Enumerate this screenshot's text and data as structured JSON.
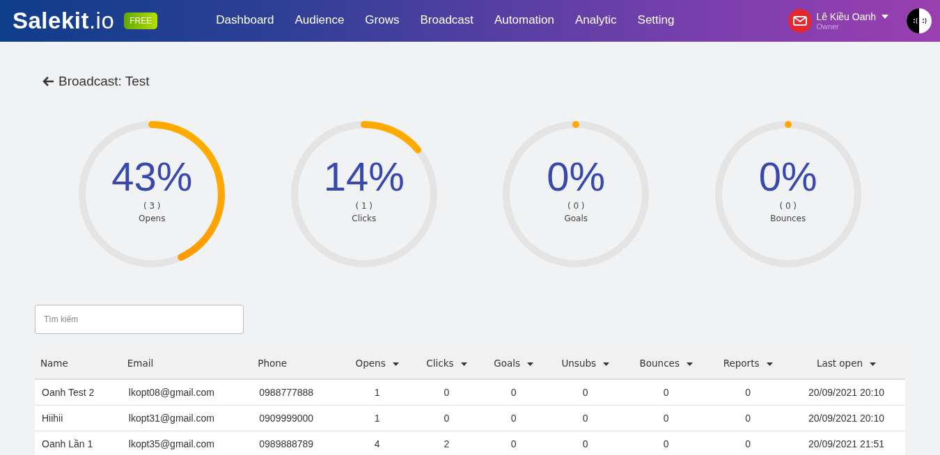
{
  "brand": {
    "name": "Salekit",
    "suffix": ".io",
    "badge": "FREE"
  },
  "nav": [
    {
      "label": "Dashboard",
      "selected": false
    },
    {
      "label": "Audience",
      "selected": false
    },
    {
      "label": "Grows",
      "selected": false
    },
    {
      "label": "Broadcast",
      "selected": false
    },
    {
      "label": "Automation",
      "selected": false
    },
    {
      "label": "Analytic",
      "selected": false
    },
    {
      "label": "Setting",
      "selected": false
    }
  ],
  "user": {
    "name": "Lê Kiều Oanh",
    "role": "Owner"
  },
  "page_title": "Broadcast: Test",
  "gauges": [
    {
      "percent": "43%",
      "count": "( 3 )",
      "label": "Opens",
      "level": 0.43
    },
    {
      "percent": "14%",
      "count": "( 1 )",
      "label": "Clicks",
      "level": 0.14
    },
    {
      "percent": "0%",
      "count": "( 0 )",
      "label": "Goals",
      "level": 0
    },
    {
      "percent": "0%",
      "count": "( 0 )",
      "label": "Bounces",
      "level": 0
    }
  ],
  "search": {
    "placeholder": "Tìm kiếm"
  },
  "table": {
    "columns": [
      {
        "label": "Name",
        "sortable": false
      },
      {
        "label": "Email",
        "sortable": false
      },
      {
        "label": "Phone",
        "sortable": false
      },
      {
        "label": "Opens",
        "sortable": true
      },
      {
        "label": "Clicks",
        "sortable": true
      },
      {
        "label": "Goals",
        "sortable": true
      },
      {
        "label": "Unsubs",
        "sortable": true
      },
      {
        "label": "Bounces",
        "sortable": true
      },
      {
        "label": "Reports",
        "sortable": true
      },
      {
        "label": "Last open",
        "sortable": true
      }
    ],
    "rows": [
      [
        "Oanh Test 2",
        "lkopt08@gmail.com",
        "0988777888",
        "1",
        "0",
        "0",
        "0",
        "0",
        "0",
        "20/09/2021 20:10"
      ],
      [
        "Hiihii",
        "lkopt31@gmail.com",
        "0909999000",
        "1",
        "0",
        "0",
        "0",
        "0",
        "0",
        "20/09/2021 20:10"
      ],
      [
        "Oanh Lần 1",
        "lkopt35@gmail.com",
        "0989888789",
        "4",
        "2",
        "0",
        "0",
        "0",
        "0",
        "20/09/2021 21:51"
      ]
    ]
  }
}
